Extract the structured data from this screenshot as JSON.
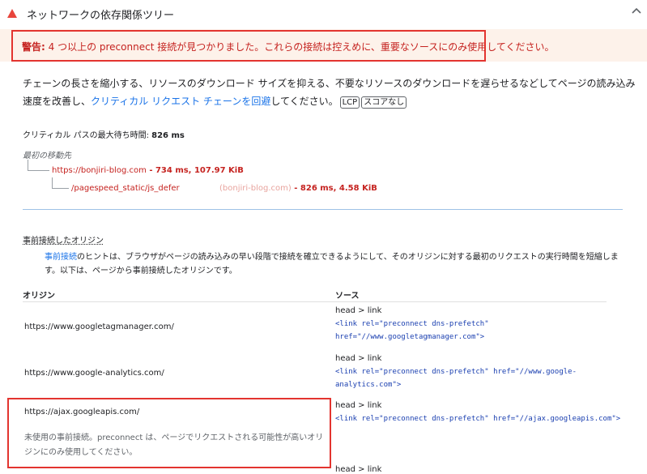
{
  "header": {
    "title": "ネットワークの依存関係ツリー",
    "status_color": "#e8453c"
  },
  "warning": {
    "label": "警告:",
    "text": " 4 つ以上の preconnect 接続が見つかりました。これらの接続は控えめに、重要なソースにのみ使用してください。"
  },
  "description": {
    "text": "チェーンの長さを縮小する、リソースのダウンロード サイズを抑える、不要なリソースのダウンロードを遅らせるなどしてページの読み込み速度を改善し、",
    "link": "クリティカル リクエスト チェーンを回避",
    "suffix": "してください。",
    "tags": [
      "LCP",
      "スコアなし"
    ]
  },
  "critical_path": {
    "label": "クリティカル パスの最大待ち時間: ",
    "value": "826 ms",
    "first_nav_label": "最初の移動先",
    "nodes": [
      {
        "url": "https://bonjiri-blog.com",
        "detail": " - 734 ms, 107.97 KiB"
      },
      {
        "url": "/pagespeed_static/js_defer",
        "host": "(bonjiri-blog.com)",
        "detail": " - 826 ms, 4.58 KiB"
      }
    ]
  },
  "preconnect": {
    "title": "事前接続したオリジン",
    "desc_link": "事前接続",
    "desc": "のヒントは、ブラウザがページの読み込みの早い段階で接続を確立できるようにして、そのオリジンに対する最初のリクエストの実行時間を短縮します。以下は、ページから事前接続したオリジンです。",
    "col_origin": "オリジン",
    "col_source": "ソース",
    "rows": [
      {
        "origin": "https://www.googletagmanager.com/",
        "head": "head > link",
        "code": "<link rel=\"preconnect dns-prefetch\" href=\"//www.googletagmanager.com\">"
      },
      {
        "origin": "https://www.google-analytics.com/",
        "head": "head > link",
        "code": "<link rel=\"preconnect dns-prefetch\" href=\"//www.google-analytics.com\">"
      },
      {
        "origin": "https://ajax.googleapis.com/",
        "head": "head > link",
        "code": "<link rel=\"preconnect dns-prefetch\" href=\"//ajax.googleapis.com\">",
        "note": "未使用の事前接続。preconnect は、ページでリクエストされる可能性が高いオリジンにのみ使用してください。"
      },
      {
        "head": "head > link"
      }
    ]
  }
}
